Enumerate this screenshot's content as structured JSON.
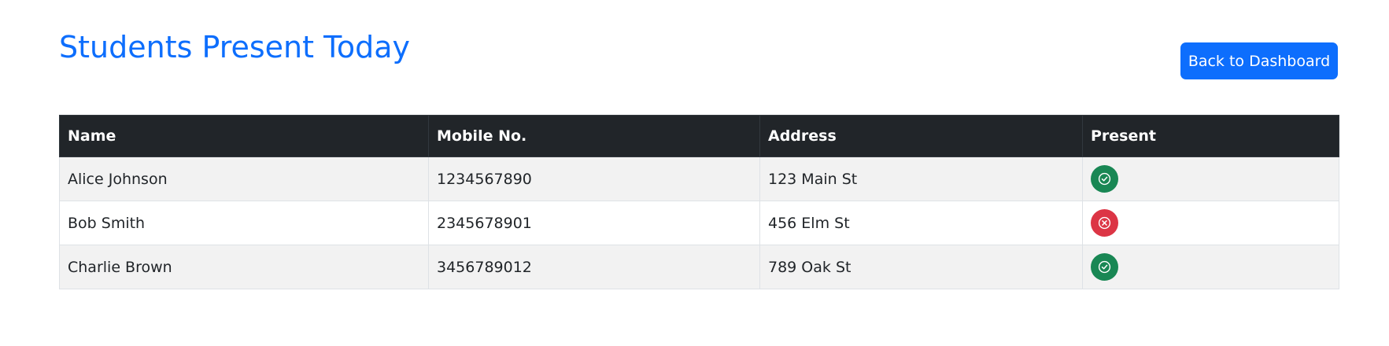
{
  "page": {
    "title": "Students Present Today",
    "back_button_label": "Back to Dashboard"
  },
  "table": {
    "columns": [
      "Name",
      "Mobile No.",
      "Address",
      "Present"
    ],
    "rows": [
      {
        "name": "Alice Johnson",
        "mobile": "1234567890",
        "address": "123 Main St",
        "present": true,
        "status_icon": "check-circle-icon"
      },
      {
        "name": "Bob Smith",
        "mobile": "2345678901",
        "address": "456 Elm St",
        "present": false,
        "status_icon": "x-circle-icon"
      },
      {
        "name": "Charlie Brown",
        "mobile": "3456789012",
        "address": "789 Oak St",
        "present": true,
        "status_icon": "check-circle-icon"
      }
    ]
  },
  "colors": {
    "accent": "#0d6efd",
    "header_bg": "#212529",
    "present": "#198754",
    "absent": "#dc3545"
  }
}
